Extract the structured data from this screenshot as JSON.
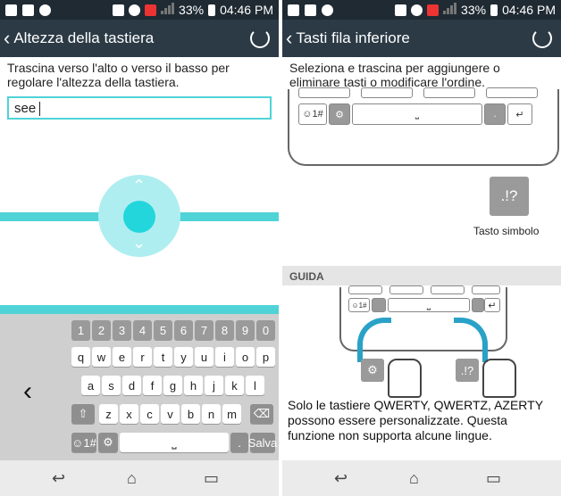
{
  "status": {
    "battery": "33%",
    "time": "04:46 PM"
  },
  "left": {
    "title": "Altezza della tastiera",
    "description": "Trascina verso l'alto o verso il basso per regolare l'altezza della tastiera.",
    "input_value": "see",
    "keys": {
      "numbers": [
        "1",
        "2",
        "3",
        "4",
        "5",
        "6",
        "7",
        "8",
        "9",
        "0"
      ],
      "row1": [
        "q",
        "w",
        "e",
        "r",
        "t",
        "y",
        "u",
        "i",
        "o",
        "p"
      ],
      "row2": [
        "a",
        "s",
        "d",
        "f",
        "g",
        "h",
        "j",
        "k",
        "l"
      ],
      "row3": [
        "z",
        "x",
        "c",
        "v",
        "b",
        "n",
        "m"
      ],
      "bottom_left": "☺1#",
      "bottom_right": "Salva"
    }
  },
  "right": {
    "title": "Tasti fila inferiore",
    "description": "Seleziona e trascina per aggiungere o eliminare tasti o modificare l'ordine.",
    "kb_key_left": "☺1#",
    "symbol_key": ".!?",
    "symbol_label": "Tasto simbolo",
    "guide_header": "GUIDA",
    "guide_key_left": "☺1#",
    "guide_text": "Solo le tastiere QWERTY, QWERTZ, AZERTY possono essere personalizzate. Questa funzione non supporta alcune lingue."
  }
}
